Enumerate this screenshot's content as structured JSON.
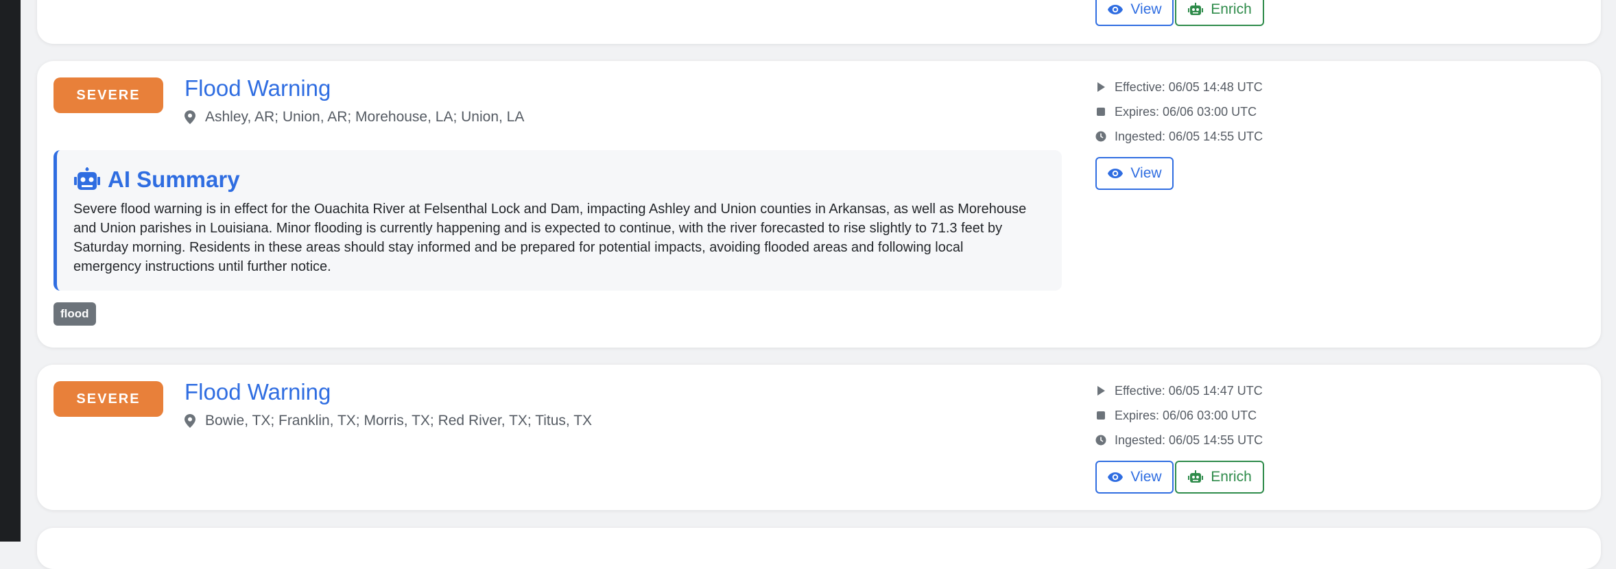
{
  "colors": {
    "severe": "#e8803a",
    "link_blue": "#2f6de1",
    "enrich_green": "#2e8b4a",
    "tag_gray": "#6c737a"
  },
  "icons": {
    "location": "map-pin-icon",
    "effective": "play-icon",
    "expires": "stop-icon",
    "ingested": "clock-icon",
    "view": "eye-icon",
    "enrich": "robot-icon",
    "ai_summary": "robot-icon"
  },
  "top_card": {
    "view_label": "View",
    "enrich_label": "Enrich"
  },
  "alerts": [
    {
      "severity": "SEVERE",
      "title": "Flood Warning",
      "location": "Ashley, AR; Union, AR; Morehouse, LA; Union, LA",
      "effective": "Effective: 06/05 14:48 UTC",
      "expires": "Expires: 06/06 03:00 UTC",
      "ingested": "Ingested: 06/05 14:55 UTC",
      "view_label": "View",
      "ai_summary": {
        "heading": "AI Summary",
        "text": "Severe flood warning is in effect for the Ouachita River at Felsenthal Lock and Dam, impacting Ashley and Union counties in Arkansas, as well as Morehouse and Union parishes in Louisiana. Minor flooding is currently happening and is expected to continue, with the river forecasted to rise slightly to 71.3 feet by Saturday morning. Residents in these areas should stay informed and be prepared for potential impacts, avoiding flooded areas and following local emergency instructions until further notice."
      },
      "tags": [
        "flood"
      ]
    },
    {
      "severity": "SEVERE",
      "title": "Flood Warning",
      "location": "Bowie, TX; Franklin, TX; Morris, TX; Red River, TX; Titus, TX",
      "effective": "Effective: 06/05 14:47 UTC",
      "expires": "Expires: 06/06 03:00 UTC",
      "ingested": "Ingested: 06/05 14:55 UTC",
      "view_label": "View",
      "enrich_label": "Enrich"
    }
  ]
}
